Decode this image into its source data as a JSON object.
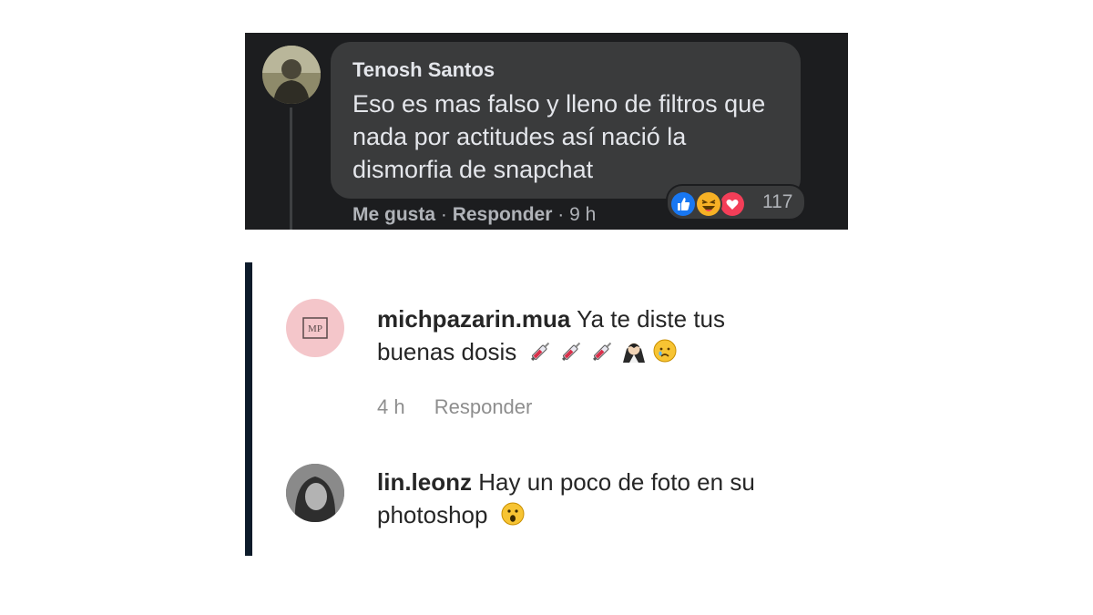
{
  "facebook_comment": {
    "author": "Tenosh Santos",
    "text": "Eso es mas falso y lleno de filtros que nada por actitudes así nació la dismorfia de snapchat",
    "like_label": "Me gusta",
    "separator": "·",
    "reply_label": "Responder",
    "time": "9 h",
    "reaction_count": "117",
    "reactions": [
      "like-icon",
      "haha-icon",
      "love-icon"
    ],
    "colors": {
      "background": "#1c1d1f",
      "bubble": "#3a3b3c",
      "like": "#1877f2",
      "haha": "#f7b125",
      "love": "#f33e58"
    }
  },
  "instagram_comments": [
    {
      "username": "michpazarin.mua",
      "text": "Ya te diste tus buenas dosis",
      "emojis": [
        "syringe-icon",
        "syringe-icon",
        "syringe-icon",
        "vampire-icon",
        "crying-face-icon"
      ],
      "time": "4 h",
      "reply_label": "Responder",
      "avatar_initials": "MP"
    },
    {
      "username": "lin.leonz",
      "text": "Hay un poco de foto en su photoshop",
      "emojis": [
        "surprised-face-icon"
      ]
    }
  ]
}
